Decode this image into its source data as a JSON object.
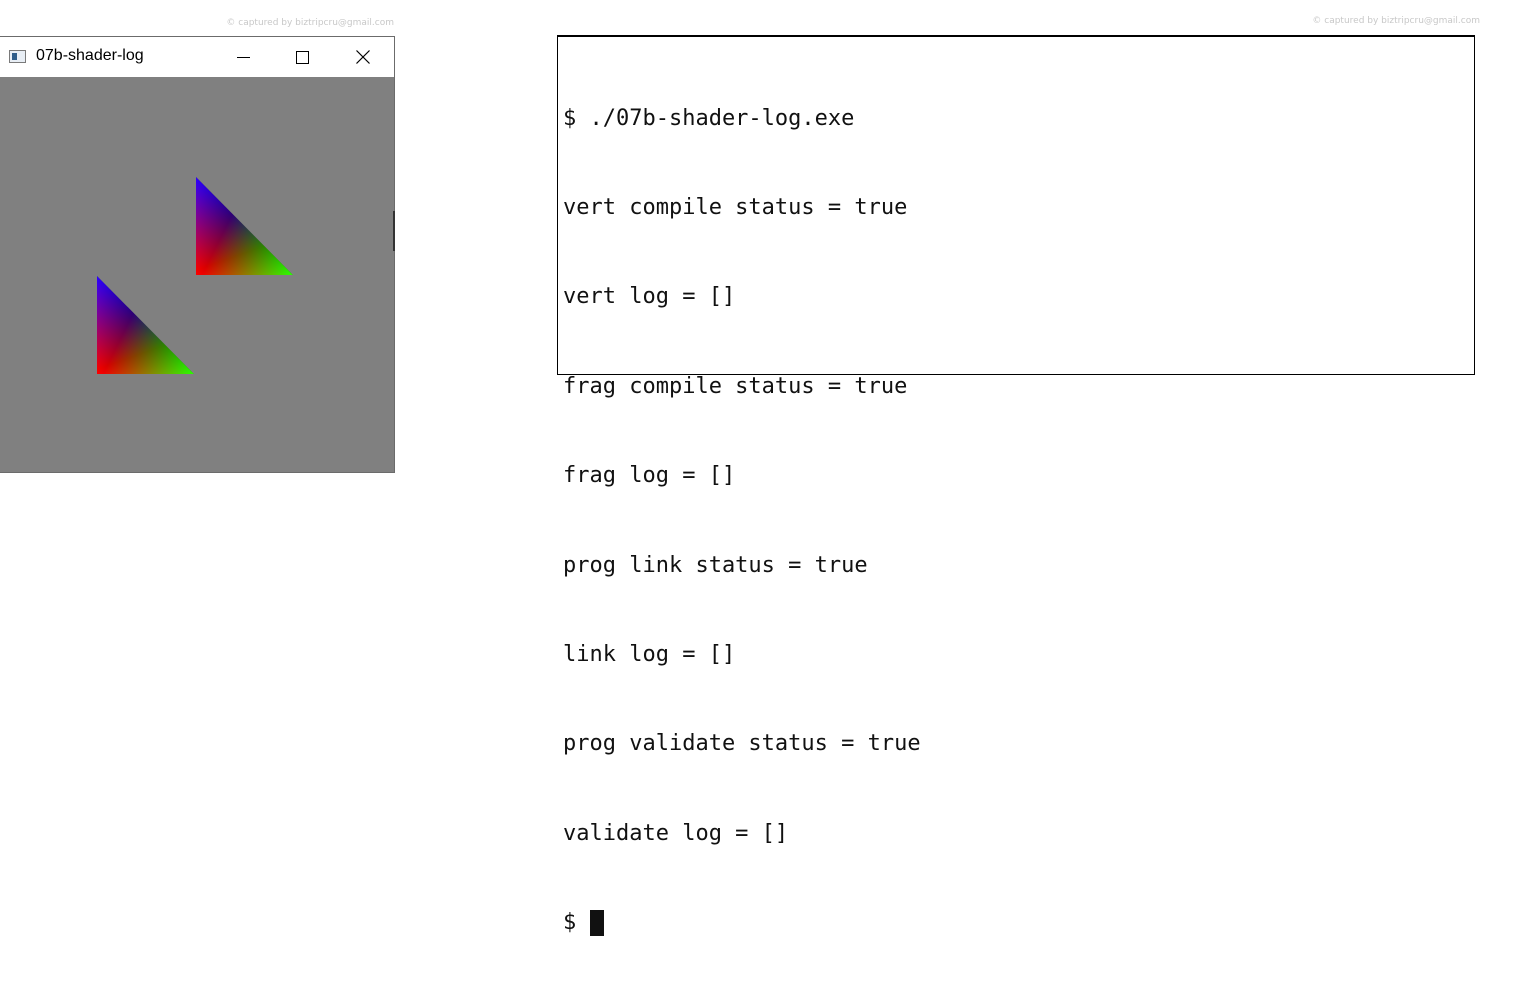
{
  "watermarks": {
    "left": "© captured by biztripcru@gmail.com",
    "right": "© captured by biztripcru@gmail.com"
  },
  "window": {
    "title": "07b-shader-log",
    "icon": "app-window-icon",
    "controls": [
      "minimize-icon",
      "maximize-icon",
      "close-icon"
    ],
    "background_color": "#808080",
    "triangles": {
      "vertex_colors": {
        "top": "#0000ff",
        "bottom_left": "#ff0000",
        "bottom_right": "#00ff00"
      }
    }
  },
  "terminal": {
    "lines": [
      "$ ./07b-shader-log.exe",
      "vert compile status = true",
      "vert log = []",
      "frag compile status = true",
      "frag log = []",
      "prog link status = true",
      "link log = []",
      "prog validate status = true",
      "validate log = []"
    ],
    "prompt": "$"
  }
}
